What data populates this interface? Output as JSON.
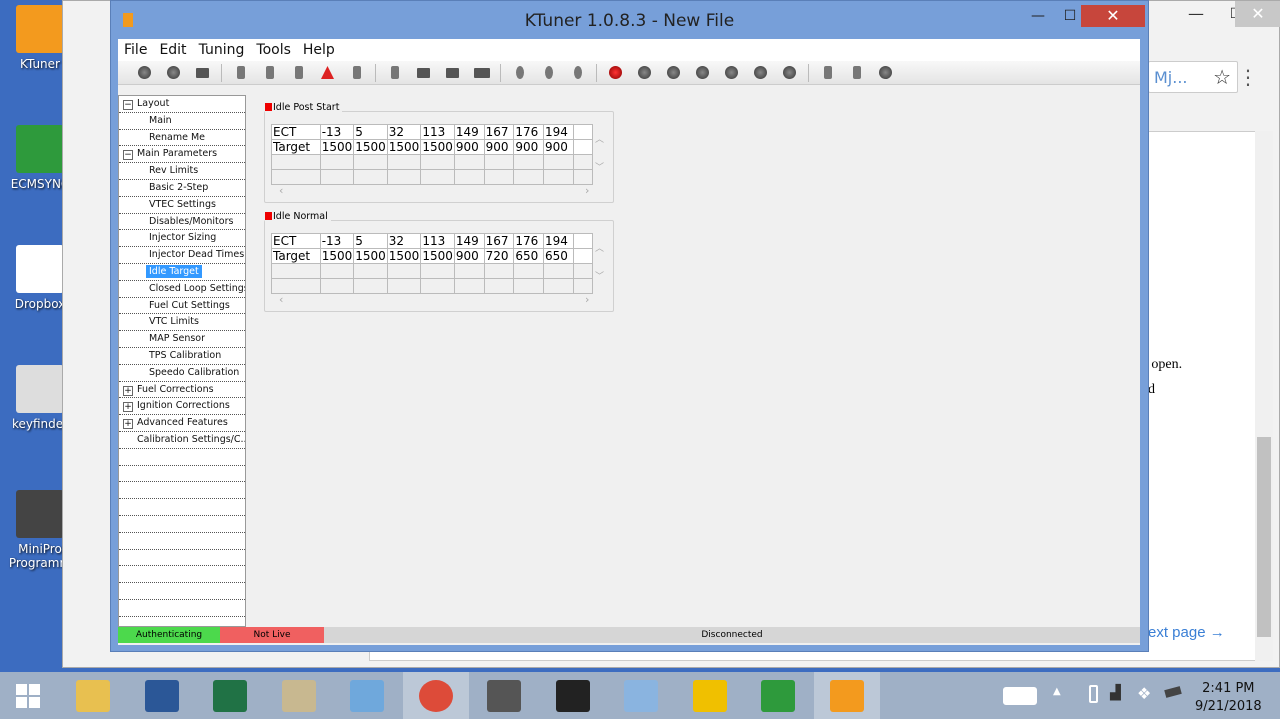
{
  "desktop": {
    "icons": [
      {
        "label": "KTuner",
        "color": "#f39a1e"
      },
      {
        "label": "ECMSYNC",
        "color": "#2e9a3c"
      },
      {
        "label": "Dropbox",
        "color": "#fff"
      },
      {
        "label": "keyfinder",
        "color": "#ddd"
      },
      {
        "label": "MiniPro Programm",
        "color": "#444"
      }
    ]
  },
  "browser": {
    "omnibox_text": "Mj...",
    "page_text": [
      "l open.",
      "d"
    ],
    "link": "ext page →",
    "min": "—",
    "max": "☐",
    "close": "✕",
    "menu": "⋮",
    "star": "☆"
  },
  "window": {
    "title": "KTuner 1.0.8.3 - New File",
    "min": "—",
    "max": "☐",
    "close": "✕"
  },
  "menu": [
    "File",
    "Edit",
    "Tuning",
    "Tools",
    "Help"
  ],
  "toolbar": [
    [
      "disconnect-icon",
      "connect-icon",
      "open-icon"
    ],
    [
      "plug-icon",
      "download-icon",
      "upload-icon",
      "warning-icon",
      "display-icon"
    ],
    [
      "tool-icon",
      "save-icon",
      "save-as-icon",
      "chip-icon"
    ],
    [
      "zoom-icon",
      "zoom-in-icon",
      "zoom-out-icon"
    ],
    [
      "record-icon",
      "rewind-start-icon",
      "rewind-icon",
      "play-icon",
      "pause-icon",
      "forward-icon",
      "forward-end-icon"
    ],
    [
      "user-icon",
      "settings-icon",
      "help-icon"
    ]
  ],
  "tree": [
    {
      "label": "Layout",
      "level": 0,
      "toggle": "−"
    },
    {
      "label": "Main",
      "level": 1
    },
    {
      "label": "Rename Me",
      "level": 1
    },
    {
      "label": "Main Parameters",
      "level": 0,
      "toggle": "−"
    },
    {
      "label": "Rev Limits",
      "level": 1
    },
    {
      "label": "Basic 2-Step",
      "level": 1
    },
    {
      "label": "VTEC Settings",
      "level": 1
    },
    {
      "label": "Disables/Monitors",
      "level": 1
    },
    {
      "label": "Injector Sizing",
      "level": 1
    },
    {
      "label": "Injector Dead Times",
      "level": 1
    },
    {
      "label": "Idle Target",
      "level": 1,
      "selected": true
    },
    {
      "label": "Closed Loop Settings",
      "level": 1
    },
    {
      "label": "Fuel Cut Settings",
      "level": 1
    },
    {
      "label": "VTC Limits",
      "level": 1
    },
    {
      "label": "MAP Sensor",
      "level": 1
    },
    {
      "label": "TPS Calibration",
      "level": 1
    },
    {
      "label": "Speedo Calibration",
      "level": 1
    },
    {
      "label": "Fuel Corrections",
      "level": 0,
      "toggle": "+"
    },
    {
      "label": "Ignition Corrections",
      "level": 0,
      "toggle": "+"
    },
    {
      "label": "Advanced Features",
      "level": 0,
      "toggle": "+"
    },
    {
      "label": "Calibration Settings/C...",
      "level": 0,
      "toggle": ""
    }
  ],
  "tables": [
    {
      "title": "Idle Post Start",
      "rows": [
        [
          "ECT",
          "-13",
          "5",
          "32",
          "113",
          "149",
          "167",
          "176",
          "194"
        ],
        [
          "Target",
          "1500",
          "1500",
          "1500",
          "1500",
          "900",
          "900",
          "900",
          "900"
        ]
      ]
    },
    {
      "title": "Idle Normal",
      "rows": [
        [
          "ECT",
          "-13",
          "5",
          "32",
          "113",
          "149",
          "167",
          "176",
          "194"
        ],
        [
          "Target",
          "1500",
          "1500",
          "1500",
          "1500",
          "900",
          "720",
          "650",
          "650"
        ]
      ]
    }
  ],
  "status": {
    "auth": "Authenticating",
    "live": "Not Live",
    "conn": "Disconnected",
    "auth_color": "#4cd94c",
    "live_color": "#f06060"
  },
  "taskbar": {
    "apps": [
      "file-explorer",
      "word",
      "excel",
      "maps",
      "control-panel",
      "chrome",
      "minipro",
      "chip-tool",
      "wordpad",
      "hondata",
      "ecmsync",
      "ktuner"
    ],
    "time": "2:41 PM",
    "date": "9/21/2018"
  }
}
